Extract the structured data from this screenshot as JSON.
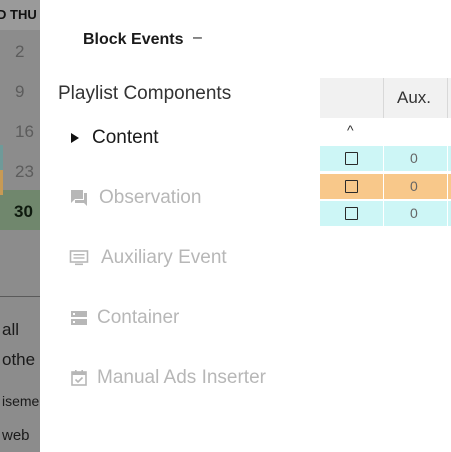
{
  "calendar": {
    "day_header_partial": "D",
    "day_header": "THU",
    "dates": [
      "2",
      "9",
      "16",
      "23",
      "30"
    ],
    "event_texts": [
      "all",
      "othe",
      "iseme",
      "web"
    ]
  },
  "panel": {
    "block_title": "Block Events",
    "collapse_symbol": "–",
    "section_title": "Playlist Components",
    "items": [
      {
        "label": "Content",
        "icon": "triangle-right-icon",
        "enabled": true
      },
      {
        "label": "Observation",
        "icon": "comment-icon",
        "enabled": false
      },
      {
        "label": "Auxiliary Event",
        "icon": "monitor-icon",
        "enabled": false
      },
      {
        "label": "Container",
        "icon": "storage-icon",
        "enabled": false
      },
      {
        "label": "Manual Ads Inserter",
        "icon": "calendar-check-icon",
        "enabled": false
      }
    ]
  },
  "grid": {
    "column_aux": "Aux.",
    "sort_symbol": "^",
    "rows": [
      {
        "aux": "0",
        "color": "#cdf6f6"
      },
      {
        "aux": "0",
        "color": "#f8c88a"
      },
      {
        "aux": "0",
        "color": "#cdf6f6"
      }
    ]
  },
  "colors": {
    "disabled_text": "#b7b7b7",
    "row_teal": "#cdf6f6",
    "row_orange": "#f8c88a",
    "overlay": "#8c8c8c"
  }
}
